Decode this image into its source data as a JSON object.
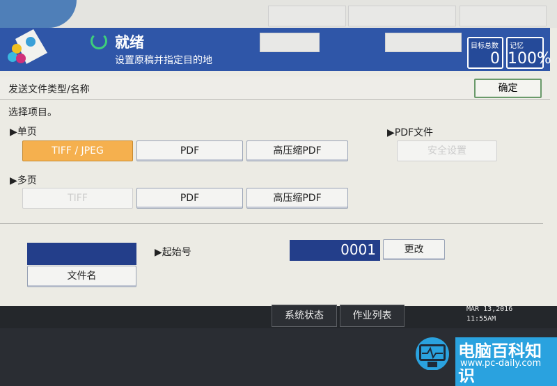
{
  "header": {
    "status": "就绪",
    "subtitle": "设置原稿并指定目的地",
    "counters": [
      {
        "label": "目标总数",
        "value": "0"
      },
      {
        "label": "记忆",
        "value": "100%"
      }
    ]
  },
  "section": {
    "title": "发送文件类型/名称",
    "ok_label": "确定",
    "prompt": "选择项目。"
  },
  "single_page": {
    "label": "▶单页",
    "buttons": [
      "TIFF / JPEG",
      "PDF",
      "高压缩PDF"
    ]
  },
  "multi_page": {
    "label": "▶多页",
    "buttons": [
      "TIFF",
      "PDF",
      "高压缩PDF"
    ]
  },
  "pdf_file": {
    "label": "▶PDF文件",
    "security_label": "安全设置"
  },
  "filename": {
    "button_label": "文件名",
    "value": ""
  },
  "start_number": {
    "label": "▶起始号",
    "value": "0001",
    "change_label": "更改"
  },
  "footer": {
    "system_status": "系统状态",
    "job_list": "作业列表",
    "date": "MAR 13,2016",
    "time": "11:55AM"
  },
  "watermark": {
    "name": "电脑百科知识",
    "url": "www.pc-daily.com"
  },
  "colors": {
    "header": "#2f56a8",
    "selected": "#f5b04e",
    "watermark": "#2aa2df"
  }
}
